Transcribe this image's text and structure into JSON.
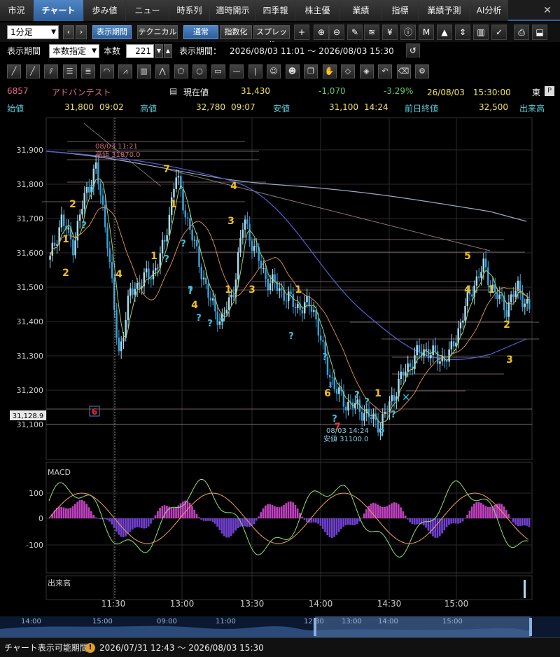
{
  "tabs": [
    {
      "label": "市況",
      "active": false
    },
    {
      "label": "チャート",
      "active": true
    },
    {
      "label": "歩み値",
      "active": false
    },
    {
      "label": "ニュース",
      "active": false
    },
    {
      "label": "時系列",
      "active": false
    },
    {
      "label": "適時開示",
      "active": false
    },
    {
      "label": "四季報",
      "active": false
    },
    {
      "label": "株主優待",
      "active": false
    },
    {
      "label": "業績",
      "active": false
    },
    {
      "label": "指標",
      "active": false
    },
    {
      "label": "業績予測",
      "active": false
    },
    {
      "label": "AI分析",
      "active": false
    }
  ],
  "toolbar": {
    "interval": "1分足",
    "period_button": "表示期間",
    "technical_button": "テクニカル",
    "normal_button": "通常",
    "index_button": "指数化",
    "spread_button": "スプレッド"
  },
  "period_bar": {
    "label": "表示期間",
    "mode": "本数指定",
    "count_label": "本数",
    "count_value": "221",
    "range_label": "表示期間：",
    "range_value": "2026/08/03 11:01 〜 2026/08/03 15:30"
  },
  "quote": {
    "code": "6857",
    "name": "アドバンテスト",
    "current_label": "現在値",
    "current": "31,430",
    "change": "-1,070",
    "change_pct": "-3.29%",
    "datetime": "26/08/03　15:30:00",
    "exchange": "東",
    "exchange_flag": "P",
    "open_label": "始値",
    "open": "31,800",
    "open_time": "09:02",
    "high_label": "高値",
    "high": "32,780",
    "high_time": "09:07",
    "low_label": "安値",
    "low": "31,100",
    "low_time": "14:24",
    "prev_label": "前日終値",
    "prev": "32,500",
    "volume_label": "出来高"
  },
  "colors": {
    "candle_up": "#a8dcf0",
    "candle_down": "#3a9fd8",
    "ma_short": "#9ad07a",
    "ma_mid": "#d08a50",
    "ma_long": "#5060d0",
    "ma_xlong": "#9aa8c0",
    "macd_line": "#f0a060",
    "signal_line": "#90e070",
    "hist_pos": "#c040c0",
    "hist_neg": "#7040d0",
    "label_num": "#f0c020",
    "label_q": "#40c0e0",
    "accent": "#2d5d99"
  },
  "chart_data": {
    "type": "line",
    "ylim": [
      31100,
      31900
    ],
    "y_ticks": [
      "31,900",
      "31,800",
      "31,700",
      "31,600",
      "31,500",
      "31,400",
      "31,300",
      "31,200",
      "31,100"
    ],
    "x_ticks": [
      "11:30",
      "13:00",
      "13:30",
      "14:00",
      "14:30",
      "15:00"
    ],
    "price_tag": "31,128.9",
    "series": [
      {
        "x": [
          "11:01",
          "11:05",
          "11:10",
          "11:15",
          "11:21",
          "11:25",
          "11:30",
          "11:40",
          "11:50",
          "12:30",
          "12:35",
          "12:40",
          "12:45",
          "12:50",
          "13:00",
          "13:05",
          "13:10",
          "13:15",
          "13:20",
          "13:25",
          "13:30",
          "13:40",
          "13:50",
          "13:55",
          "14:00",
          "14:05",
          "14:10",
          "14:15",
          "14:20",
          "14:24",
          "14:30",
          "14:35",
          "14:40",
          "14:45",
          "14:50",
          "14:55",
          "15:00",
          "15:05",
          "15:10",
          "15:15",
          "15:20",
          "15:25",
          "15:30"
        ],
        "values": [
          31580,
          31700,
          31620,
          31760,
          31850,
          31650,
          31300,
          31480,
          31520,
          31540,
          31620,
          31830,
          31700,
          31580,
          31460,
          31400,
          31480,
          31700,
          31600,
          31520,
          31500,
          31460,
          31440,
          31450,
          31300,
          31200,
          31160,
          31150,
          31120,
          31100,
          31180,
          31250,
          31300,
          31320,
          31290,
          31300,
          31400,
          31500,
          31560,
          31480,
          31440,
          31500,
          31430
        ]
      }
    ],
    "annotations": [
      {
        "text": "08/03 11:21",
        "sub": "高値 31870.0"
      },
      {
        "text": "08/03 14:24",
        "sub": "安値 31100.0"
      }
    ],
    "macd": {
      "label": "MACD",
      "y_ticks": [
        "100",
        "0",
        "-100"
      ]
    },
    "volume": {
      "label": "出来高"
    },
    "navigator_ticks": [
      "14:00",
      "15:00",
      "09:00",
      "11:00",
      "12:30",
      "13:00",
      "14:00",
      "15:00"
    ]
  },
  "footer": {
    "label": "チャート表示可能期間",
    "range": "2026/07/31 12:43 〜 2026/08/03 15:30"
  }
}
